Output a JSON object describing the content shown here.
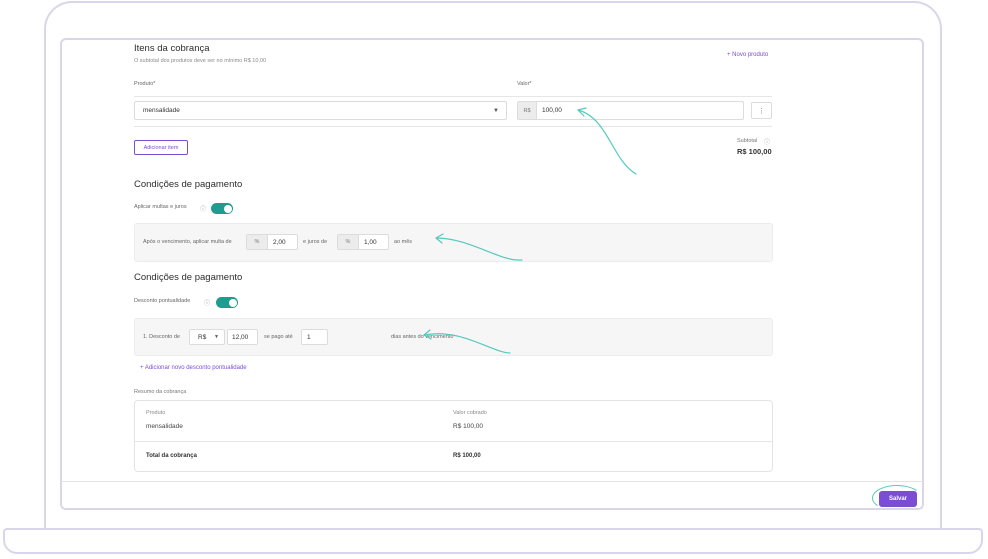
{
  "items_section": {
    "title": "Itens da cobrança",
    "subtitle": "O subtotal dos produtos deve ser no mínimo R$ 10,00",
    "new_product_link": "+ Novo produto",
    "product_label": "Produto*",
    "value_label": "Valor*",
    "product_value": "mensalidade",
    "currency_prefix": "R$",
    "amount_value": "100,00",
    "more_menu": "⋮",
    "add_item_button": "Adicionar item",
    "subtotal_label": "Subtotal",
    "subtotal_value": "R$ 100,00"
  },
  "fines_section": {
    "title": "Condições de pagamento",
    "toggle_label": "Aplicar multas e juros",
    "toggle_on": true,
    "text_before": "Após o vencimento, aplicar multa de",
    "fine_prefix": "%",
    "fine_value": "2,00",
    "text_middle": "e juros de",
    "interest_prefix": "%",
    "interest_value": "1,00",
    "text_after": "ao mês"
  },
  "discount_section": {
    "title": "Condições de pagamento",
    "toggle_label": "Desconto pontualidade",
    "toggle_on": true,
    "row_label": "1. Desconto de",
    "currency_select": "R$",
    "discount_value": "12,00",
    "text_middle": "se pago até",
    "days_value": "1",
    "text_after": "dias antes do vencimento",
    "add_discount_link": "+ Adicionar novo desconto pontualidade"
  },
  "summary": {
    "title": "Resumo da cobrança",
    "col_product": "Produto",
    "col_value": "Valor cobrado",
    "row_product": "mensalidade",
    "row_value": "R$ 100,00",
    "total_label": "Total da cobrança",
    "total_value": "R$ 100,00"
  },
  "footer": {
    "save_button": "Salvar"
  },
  "colors": {
    "accent": "#7b4dd0",
    "toggle": "#1f9b8f",
    "annotation": "#55c9bd"
  },
  "icons": {
    "dropdown": "chevron-down-icon",
    "info": "info-icon",
    "more": "kebab-menu-icon"
  }
}
